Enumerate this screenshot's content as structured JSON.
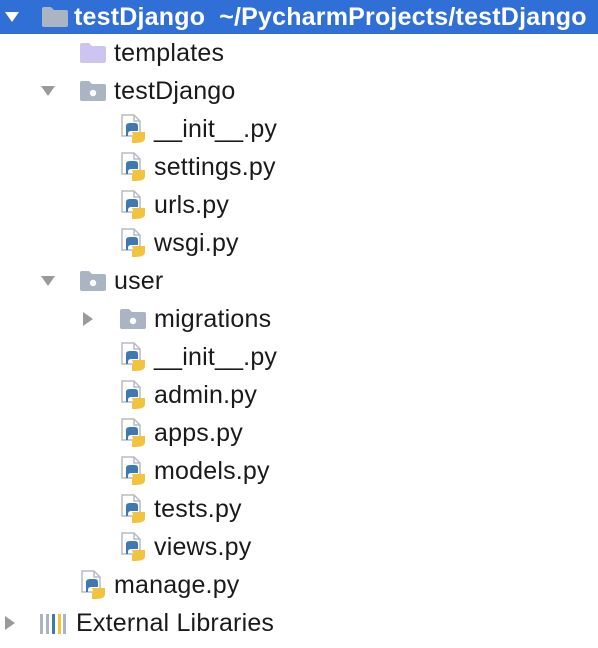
{
  "project": {
    "name": "testDjango",
    "path": "~/PycharmProjects/testDjango"
  },
  "tree": {
    "templates": "templates",
    "testDjango_pkg": "testDjango",
    "init_1": "__init__.py",
    "settings": "settings.py",
    "urls": "urls.py",
    "wsgi": "wsgi.py",
    "user": "user",
    "migrations": "migrations",
    "init_2": "__init__.py",
    "admin": "admin.py",
    "apps": "apps.py",
    "models": "models.py",
    "tests": "tests.py",
    "views": "views.py",
    "manage": "manage.py",
    "external": "External Libraries"
  },
  "colors": {
    "selection": "#2f6fd6",
    "folder": "#aab4c2",
    "template_folder": "#cdc4ef",
    "python_blue": "#3f79b3",
    "python_yellow": "#f2c43d",
    "arrow": "#9a9a9a"
  },
  "icons": {
    "expanded": "chevron-down-icon",
    "collapsed": "chevron-right-icon",
    "folder": "folder-icon",
    "package": "package-folder-icon",
    "python": "python-file-icon",
    "libraries": "library-icon"
  }
}
